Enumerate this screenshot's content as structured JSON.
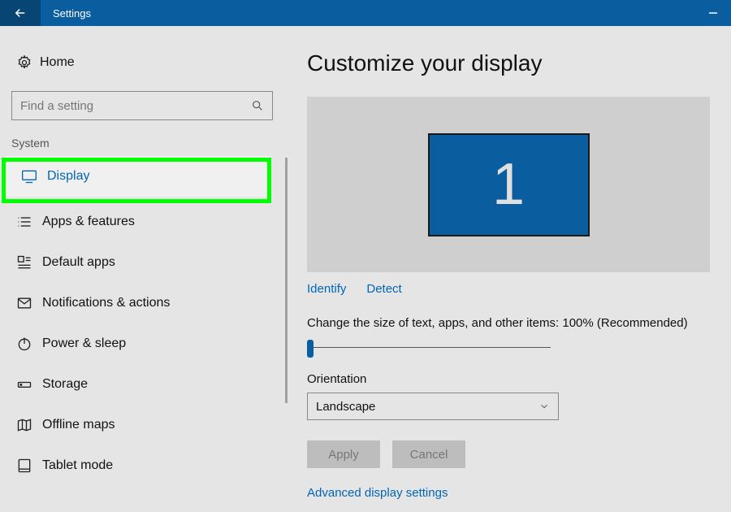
{
  "title": "Settings",
  "sidebar": {
    "home_label": "Home",
    "search_placeholder": "Find a setting",
    "category": "System",
    "items": [
      {
        "label": "Display"
      },
      {
        "label": "Apps & features"
      },
      {
        "label": "Default apps"
      },
      {
        "label": "Notifications & actions"
      },
      {
        "label": "Power & sleep"
      },
      {
        "label": "Storage"
      },
      {
        "label": "Offline maps"
      },
      {
        "label": "Tablet mode"
      }
    ]
  },
  "main": {
    "heading": "Customize your display",
    "monitor_number": "1",
    "identify_label": "Identify",
    "detect_label": "Detect",
    "scale_label": "Change the size of text, apps, and other items: 100% (Recommended)",
    "orientation_label": "Orientation",
    "orientation_value": "Landscape",
    "apply_label": "Apply",
    "cancel_label": "Cancel",
    "advanced_label": "Advanced display settings"
  }
}
